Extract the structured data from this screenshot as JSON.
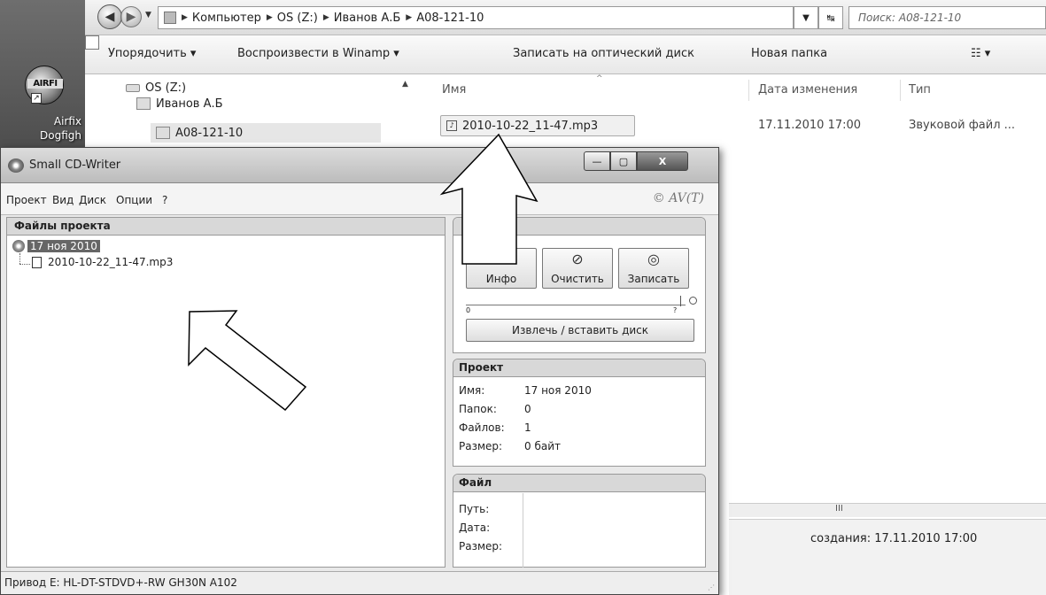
{
  "desktop": {
    "icon_logo_text": "AIRFI",
    "icon_label_line1": "Airfix",
    "icon_label_line2": "Dogfigh"
  },
  "explorer": {
    "breadcrumbs": [
      "Компьютер",
      "OS (Z:)",
      "Иванов А.Б",
      "A08-121-10"
    ],
    "search_placeholder": "Поиск: A08-121-10",
    "toolbar": {
      "organize": "Упорядочить ▾",
      "play": "Воспроизвести в Winamp ▾",
      "burn": "Записать на оптический диск",
      "new_folder": "Новая папка",
      "view": "☷ ▾"
    },
    "nav": {
      "drive": "OS (Z:)",
      "folder": "Иванов А.Б",
      "subfolder": "A08-121-10"
    },
    "columns": {
      "name": "Имя",
      "date": "Дата изменения",
      "type": "Тип"
    },
    "file": {
      "name": "2010-10-22_11-47.mp3",
      "date": "17.11.2010 17:00",
      "type": "Звуковой файл ..."
    },
    "details_text": "создания: 17.11.2010 17:00",
    "hscroll_text": "III"
  },
  "cdwriter": {
    "title": "Small CD-Writer",
    "window_buttons": {
      "minimize": "—",
      "maximize": "▢",
      "close": "X"
    },
    "menu": [
      "Проект",
      "Вид",
      "Диск",
      "Опции",
      "?"
    ],
    "copyright": "© AV(T)",
    "project_panel_title": "Файлы проекта",
    "tree_root": "17 ноя 2010",
    "tree_file": "2010-10-22_11-47.mp3",
    "buttons": {
      "info": "Инфо",
      "clear": "Очистить",
      "burn": "Записать",
      "eject": "Извлечь / вставить диск"
    },
    "speed_min": "0",
    "speed_max": "?",
    "project_info": {
      "title": "Проект",
      "name_label": "Имя:",
      "name_value": "17 ноя 2010",
      "folders_label": "Папок:",
      "folders_value": "0",
      "files_label": "Файлов:",
      "files_value": "1",
      "size_label": "Размер:",
      "size_value": "0 байт"
    },
    "file_info": {
      "title": "Файл",
      "path_label": "Путь:",
      "date_label": "Дата:",
      "size_label": "Размер:"
    },
    "status": "Привод  E: HL-DT-STDVD+-RW GH30N A102"
  },
  "colors": {
    "title_gradient_top": "#dcdcdc",
    "panel_header": "#d8d8d8",
    "selection": "#666666"
  }
}
